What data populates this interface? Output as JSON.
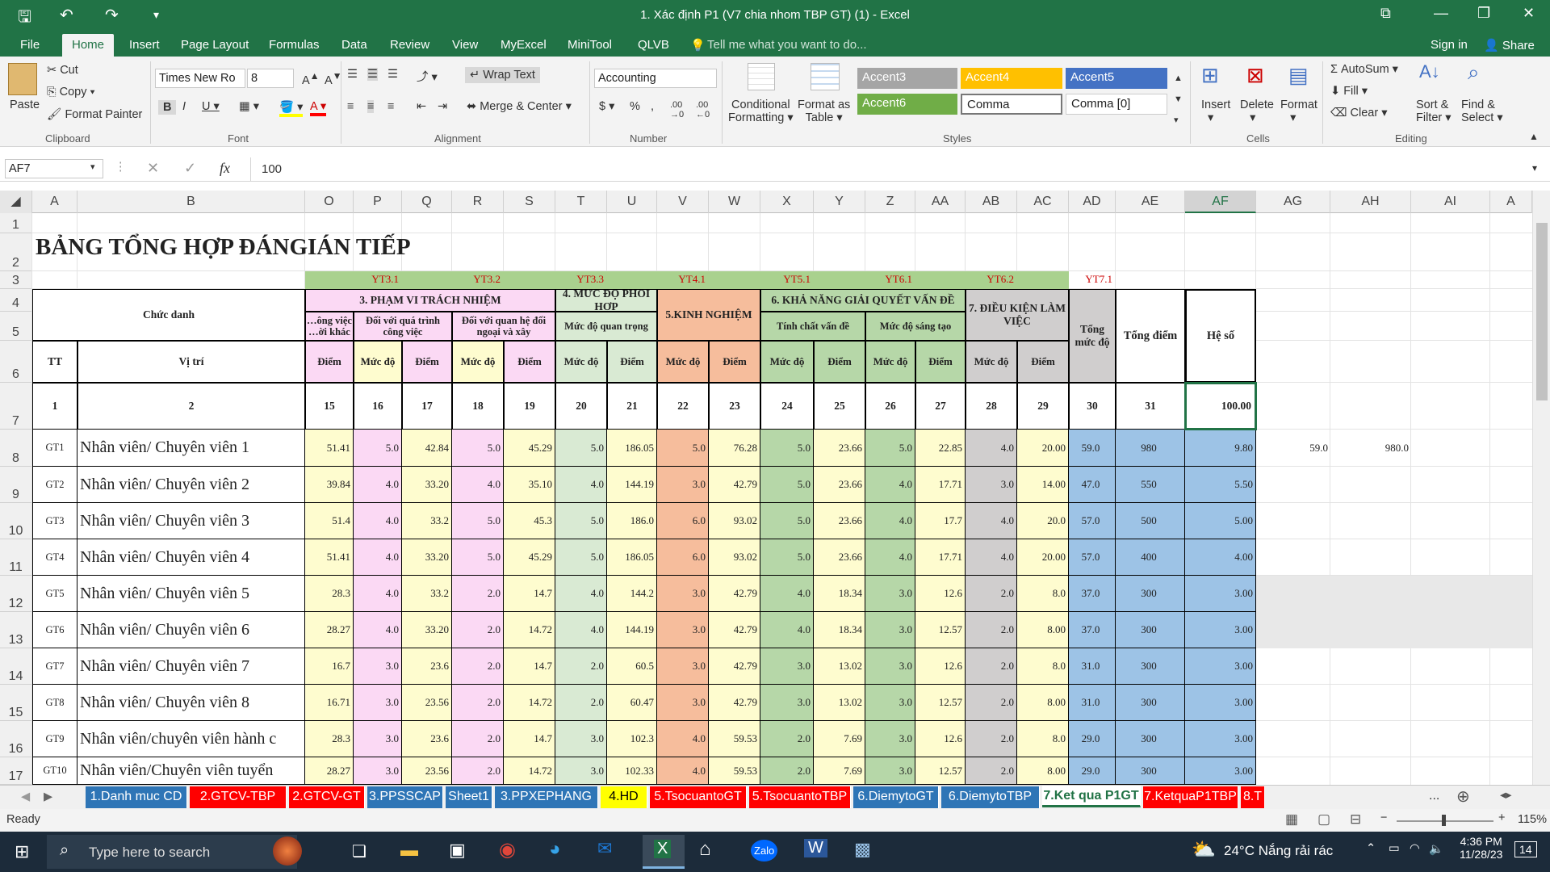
{
  "window": {
    "title": "1. Xác định P1  (V7 chia nhom TBP GT) (1)  -  Excel"
  },
  "menu": {
    "file": "File",
    "tabs": [
      "Home",
      "Insert",
      "Page Layout",
      "Formulas",
      "Data",
      "Review",
      "View",
      "MyExcel",
      "MiniTool",
      "QLVB"
    ],
    "tell": "Tell me what you want to do...",
    "signin": "Sign in",
    "share": "Share"
  },
  "ribbon": {
    "clipboard": {
      "paste": "Paste",
      "cut": "Cut",
      "copy": "Copy",
      "painter": "Format Painter",
      "label": "Clipboard"
    },
    "font": {
      "name": "Times New Ro",
      "size": "8",
      "label": "Font"
    },
    "alignment": {
      "wrap": "Wrap Text",
      "merge": "Merge & Center",
      "label": "Alignment"
    },
    "number": {
      "format": "Accounting",
      "label": "Number"
    },
    "styles": {
      "cond1": "Conditional",
      "cond2": "Formatting",
      "fmt1": "Format as",
      "fmt2": "Table",
      "items": [
        "Accent3",
        "Accent4",
        "Accent5",
        "Accent6",
        "Comma",
        "Comma [0]"
      ],
      "label": "Styles"
    },
    "cells": {
      "insert": "Insert",
      "delete": "Delete",
      "format": "Format",
      "label": "Cells"
    },
    "editing": {
      "autosum": "AutoSum",
      "fill": "Fill",
      "clear": "Clear",
      "sort1": "Sort &",
      "sort2": "Filter",
      "find1": "Find &",
      "find2": "Select",
      "label": "Editing"
    }
  },
  "formula": {
    "namebox": "AF7",
    "value": "100"
  },
  "columns": [
    "A",
    "B",
    "O",
    "P",
    "Q",
    "R",
    "S",
    "T",
    "U",
    "V",
    "W",
    "X",
    "Y",
    "Z",
    "AA",
    "AB",
    "AC",
    "AD",
    "AE",
    "AF",
    "AG",
    "AH",
    "AI",
    "A"
  ],
  "rows": [
    "1",
    "2",
    "3",
    "4",
    "5",
    "6",
    "7",
    "8",
    "9",
    "10",
    "11",
    "12",
    "13",
    "14",
    "15",
    "16",
    "17"
  ],
  "sheet": {
    "title": "BẢNG TỔNG HỢP ĐÁNGIÁN TIẾP",
    "yt": [
      "YT3.1",
      "YT3.2",
      "YT3.3",
      "YT4.1",
      "YT5.1",
      "YT6.1",
      "YT6.2",
      "YT7.1"
    ],
    "h": {
      "chucdanh": "Chức danh",
      "tt": "TT",
      "vitri": "Vị trí",
      "g3": "3. PHẠM VI TRÁCH NHIỆM",
      "s31": "…ông việc …ời khác",
      "s32": "Đối với quá trình công việc",
      "s33": "Đối với quan hệ đối ngoại và xây",
      "g4": "4. MỨC ĐỘ PHỐI HỢP",
      "s41": "Mức độ quan trọng",
      "g5": "5.KINH NGHIỆM",
      "g6": "6. KHẢ NĂNG GIẢI QUYẾT VẤN ĐỀ",
      "s61": "Tính chất vấn đề",
      "s62": "Mức độ sáng tạo",
      "g7": "7. ĐIỀU KIỆN LÀM VIỆC",
      "tongmucdo": "Tổng mức độ",
      "tongdiem": "Tổng điểm",
      "heso": "Hệ số",
      "diem": "Điểm",
      "mucdo": "Mức độ"
    },
    "nums": [
      "1",
      "2",
      "15",
      "16",
      "17",
      "18",
      "19",
      "20",
      "21",
      "22",
      "23",
      "24",
      "25",
      "26",
      "27",
      "28",
      "29",
      "30",
      "31",
      "100.00"
    ],
    "extra": [
      "59.0",
      "980.0"
    ],
    "data": [
      [
        "GT1",
        "Nhân viên/ Chuyên viên 1",
        "51.41",
        "5.0",
        "42.84",
        "5.0",
        "45.29",
        "5.0",
        "186.05",
        "5.0",
        "76.28",
        "5.0",
        "23.66",
        "5.0",
        "22.85",
        "4.0",
        "20.00",
        "59.0",
        "980",
        "9.80"
      ],
      [
        "GT2",
        "Nhân viên/ Chuyên viên 2",
        "39.84",
        "4.0",
        "33.20",
        "4.0",
        "35.10",
        "4.0",
        "144.19",
        "3.0",
        "42.79",
        "5.0",
        "23.66",
        "4.0",
        "17.71",
        "3.0",
        "14.00",
        "47.0",
        "550",
        "5.50"
      ],
      [
        "GT3",
        "Nhân viên/ Chuyên viên 3",
        "51.4",
        "4.0",
        "33.2",
        "5.0",
        "45.3",
        "5.0",
        "186.0",
        "6.0",
        "93.02",
        "5.0",
        "23.66",
        "4.0",
        "17.7",
        "4.0",
        "20.0",
        "57.0",
        "500",
        "5.00"
      ],
      [
        "GT4",
        "Nhân viên/ Chuyên viên 4",
        "51.41",
        "4.0",
        "33.20",
        "5.0",
        "45.29",
        "5.0",
        "186.05",
        "6.0",
        "93.02",
        "5.0",
        "23.66",
        "4.0",
        "17.71",
        "4.0",
        "20.00",
        "57.0",
        "400",
        "4.00"
      ],
      [
        "GT5",
        "Nhân viên/ Chuyên viên 5",
        "28.3",
        "4.0",
        "33.2",
        "2.0",
        "14.7",
        "4.0",
        "144.2",
        "3.0",
        "42.79",
        "4.0",
        "18.34",
        "3.0",
        "12.6",
        "2.0",
        "8.0",
        "37.0",
        "300",
        "3.00"
      ],
      [
        "GT6",
        "Nhân viên/ Chuyên viên 6",
        "28.27",
        "4.0",
        "33.20",
        "2.0",
        "14.72",
        "4.0",
        "144.19",
        "3.0",
        "42.79",
        "4.0",
        "18.34",
        "3.0",
        "12.57",
        "2.0",
        "8.00",
        "37.0",
        "300",
        "3.00"
      ],
      [
        "GT7",
        "Nhân viên/ Chuyên viên 7",
        "16.7",
        "3.0",
        "23.6",
        "2.0",
        "14.7",
        "2.0",
        "60.5",
        "3.0",
        "42.79",
        "3.0",
        "13.02",
        "3.0",
        "12.6",
        "2.0",
        "8.0",
        "31.0",
        "300",
        "3.00"
      ],
      [
        "GT8",
        "Nhân viên/ Chuyên viên 8",
        "16.71",
        "3.0",
        "23.56",
        "2.0",
        "14.72",
        "2.0",
        "60.47",
        "3.0",
        "42.79",
        "3.0",
        "13.02",
        "3.0",
        "12.57",
        "2.0",
        "8.00",
        "31.0",
        "300",
        "3.00"
      ],
      [
        "GT9",
        "Nhân viên/chuyên viên hành c",
        "28.3",
        "3.0",
        "23.6",
        "2.0",
        "14.7",
        "3.0",
        "102.3",
        "4.0",
        "59.53",
        "2.0",
        "7.69",
        "3.0",
        "12.6",
        "2.0",
        "8.0",
        "29.0",
        "300",
        "3.00"
      ],
      [
        "GT10",
        "Nhân viên/Chuyên viên tuyển",
        "28.27",
        "3.0",
        "23.56",
        "2.0",
        "14.72",
        "3.0",
        "102.33",
        "4.0",
        "59.53",
        "2.0",
        "7.69",
        "3.0",
        "12.57",
        "2.0",
        "8.00",
        "29.0",
        "300",
        "3.00"
      ]
    ]
  },
  "tabs": [
    "1.Danh muc CD",
    "2.GTCV-TBP",
    "2.GTCV-GT",
    "3.PPSSCAP",
    "Sheet1",
    "3.PPXEPHANG",
    "4.HD",
    "5.TsocuantoGT",
    "5.TsocuantoTBP",
    "6.DiemytoGT",
    "6.DiemytoTBP",
    "7.Ket qua P1GT",
    "7.KetquaP1TBP",
    "8.T"
  ],
  "tabs_more": "...",
  "status": {
    "ready": "Ready",
    "zoom": "115%"
  },
  "taskbar": {
    "search": "Type here to search",
    "weather": "24°C  Nắng rải rác",
    "time": "4:36 PM",
    "date": "11/28/23",
    "notif": "14"
  },
  "colors": {
    "excel_green": "#217346",
    "pink": "#fbd9f4",
    "yellow": "#fefccf",
    "mint": "#d9ead3",
    "salmon": "#f6bd9c",
    "green": "#b6d7a8",
    "gray": "#d0cece",
    "blue": "#9dc3e6",
    "lime": "#a9d18e"
  }
}
